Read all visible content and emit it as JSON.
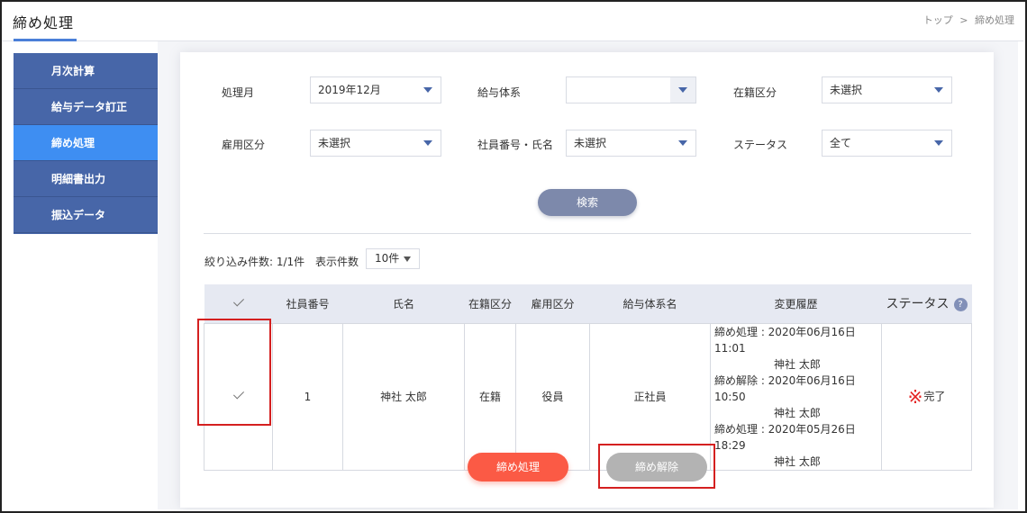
{
  "header": {
    "title": "締め処理",
    "breadcrumb": [
      "トップ",
      ">",
      "締め処理"
    ]
  },
  "sidebar": {
    "items": [
      {
        "label": "月次計算"
      },
      {
        "label": "給与データ訂正"
      },
      {
        "label": "締め処理"
      },
      {
        "label": "明細書出力"
      },
      {
        "label": "振込データ"
      }
    ]
  },
  "filters": {
    "month_label": "処理月",
    "month_value": "2019年12月",
    "pay_system_label": "給与体系",
    "pay_system_value": "",
    "enrollment_label": "在籍区分",
    "enrollment_value": "未選択",
    "employment_label": "雇用区分",
    "employment_value": "未選択",
    "employee_label": "社員番号・氏名",
    "employee_value": "未選択",
    "status_label": "ステータス",
    "status_value": "全て"
  },
  "search_button": "検索",
  "result": {
    "count_text": "絞り込み件数: 1/1件",
    "per_page_label": "表示件数",
    "per_page_value": "10件"
  },
  "table": {
    "headers": [
      "社員番号",
      "氏名",
      "在籍区分",
      "雇用区分",
      "給与体系名",
      "変更履歴",
      "ステータス"
    ],
    "help_icon": "?",
    "rows": [
      {
        "checked": true,
        "employee_no": "1",
        "name": "神社 太郎",
        "enrollment": "在籍",
        "employment": "役員",
        "pay_system": "正社員",
        "history": [
          {
            "entry": "締め処理 : 2020年06月16日 11:01",
            "by": "神社 太郎"
          },
          {
            "entry": "締め解除 : 2020年06月16日 10:50",
            "by": "神社 太郎"
          },
          {
            "entry": "締め処理 : 2020年05月26日 18:29",
            "by": "神社 太郎"
          }
        ],
        "status_mark": "※",
        "status": "完了"
      }
    ]
  },
  "actions": {
    "close_label": "締め処理",
    "release_label": "締め解除"
  },
  "colors": {
    "sidebar": "#4766a8",
    "sidebar_active": "#3e8ef2",
    "primary_action": "#fb5a45",
    "disabled_action": "#b3b3b3",
    "highlight_box": "#d42020"
  }
}
